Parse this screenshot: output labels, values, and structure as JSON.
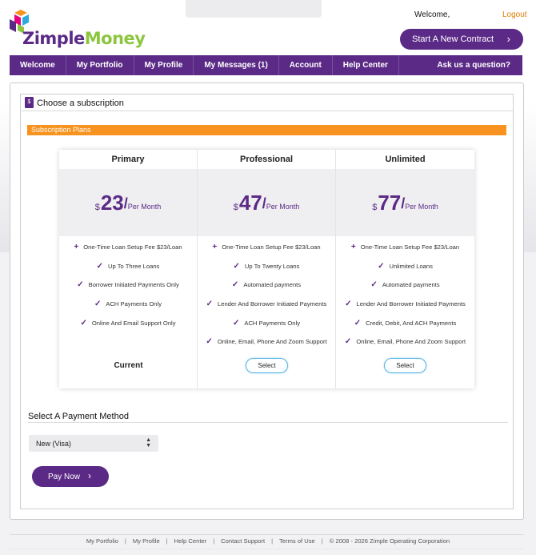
{
  "header": {
    "logo_zimple": "Zimple",
    "logo_money": "Money",
    "welcome": "Welcome,",
    "logout": "Logout",
    "start_contract": "Start A New Contract"
  },
  "nav": {
    "items": [
      "Welcome",
      "My Portfolio",
      "My Profile",
      "My Messages (1)",
      "Account",
      "Help Center"
    ],
    "ask": "Ask us a question?"
  },
  "card": {
    "title": "Choose a subscription",
    "plans_label": "Subscription Plans"
  },
  "plans": [
    {
      "name": "Primary",
      "currency": "$",
      "price": "23",
      "per": "Per Month",
      "features": [
        {
          "mark": "plus",
          "text": "One-Time Loan Setup Fee $23/Loan"
        },
        {
          "mark": "check",
          "text": "Up To Three Loans"
        },
        {
          "mark": "check",
          "text": "Borrower Initiated Payments Only"
        },
        {
          "mark": "check",
          "text": "ACH Payments Only"
        },
        {
          "mark": "check",
          "text": "Online And Email Support Only"
        }
      ],
      "action": "Current",
      "action_type": "label"
    },
    {
      "name": "Professional",
      "currency": "$",
      "price": "47",
      "per": "Per Month",
      "features": [
        {
          "mark": "plus",
          "text": "One-Time Loan Setup Fee $23/Loan"
        },
        {
          "mark": "check",
          "text": "Up To Twenty Loans"
        },
        {
          "mark": "check",
          "text": "Automated payments"
        },
        {
          "mark": "check",
          "text": "Lender And Borrower Initiated Payments"
        },
        {
          "mark": "check",
          "text": "ACH Payments Only"
        },
        {
          "mark": "check",
          "text": "Online, Email, Phone And Zoom Support"
        }
      ],
      "action": "Select",
      "action_type": "button"
    },
    {
      "name": "Unlimited",
      "currency": "$",
      "price": "77",
      "per": "Per Month",
      "features": [
        {
          "mark": "plus",
          "text": "One-Time Loan Setup Fee $23/Loan"
        },
        {
          "mark": "check",
          "text": "Unlimited Loans"
        },
        {
          "mark": "check",
          "text": "Automated payments"
        },
        {
          "mark": "check",
          "text": "Lender And Borrower Initiated Payments"
        },
        {
          "mark": "check",
          "text": "Credit, Debit, And ACH Payments"
        },
        {
          "mark": "check",
          "text": "Online, Email, Phone And Zoom Support"
        }
      ],
      "action": "Select",
      "action_type": "button"
    }
  ],
  "payment": {
    "title": "Select A Payment Method",
    "selected": "New (Visa)",
    "pay_button": "Pay Now"
  },
  "footer": {
    "links": [
      "My Portfolio",
      "My Profile",
      "Help Center",
      "Contact Support",
      "Terms of Use"
    ],
    "copyright": "© 2008 - 2026 Zimple Operating Corporation"
  },
  "colors": {
    "brand_purple": "#5b2a86",
    "brand_green": "#8cc63f",
    "accent_orange": "#f7931e",
    "select_border": "#5ab4e5"
  }
}
